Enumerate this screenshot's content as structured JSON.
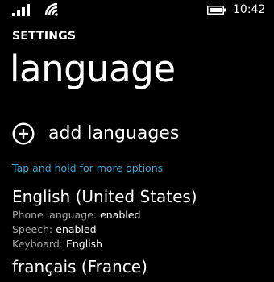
{
  "status_bar": {
    "time": "10:42",
    "icons": [
      "signal-icon",
      "wifi-icon",
      "battery-icon"
    ]
  },
  "header": {
    "section": "SETTINGS",
    "title": "language"
  },
  "actions": {
    "add_label": "add languages",
    "add_icon": "plus-circle-icon"
  },
  "hint": "Tap and hold for more options",
  "languages": [
    {
      "name": "English (United States)",
      "details": [
        {
          "label": "Phone language:",
          "value": "enabled"
        },
        {
          "label": "Speech:",
          "value": "enabled"
        },
        {
          "label": "Keyboard:",
          "value": "English"
        }
      ]
    },
    {
      "name": "français (France)"
    }
  ],
  "colors": {
    "background": "#000000",
    "accent": "#3aa6d6",
    "text": "#ffffff",
    "secondary_text": "#a8a8a8"
  }
}
